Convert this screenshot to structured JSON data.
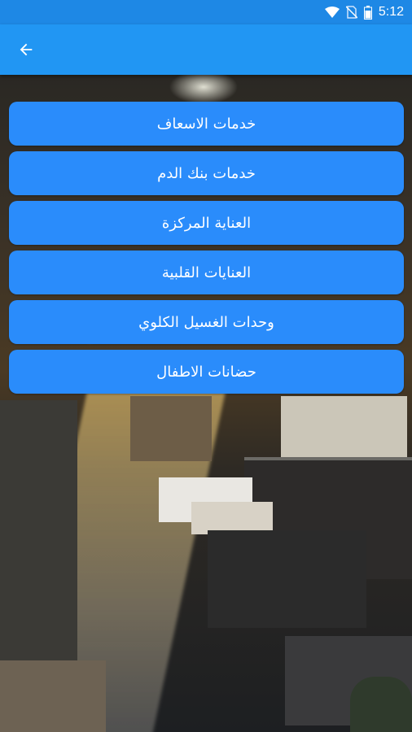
{
  "status_bar": {
    "time": "5:12",
    "icons": [
      "wifi-icon",
      "no-sim-icon",
      "battery-icon"
    ]
  },
  "app_bar": {
    "back_icon": "arrow-back-icon",
    "color": "#2196f3"
  },
  "menu": {
    "button_color": "#2a8cfb",
    "items": [
      {
        "label": "خدمات الاسعاف"
      },
      {
        "label": "خدمات بنك الدم"
      },
      {
        "label": "العناية المركزة"
      },
      {
        "label": "العنايات القلبية"
      },
      {
        "label": "وحدات الغسيل الكلوي"
      },
      {
        "label": "حضانات  الاطفال"
      }
    ]
  }
}
